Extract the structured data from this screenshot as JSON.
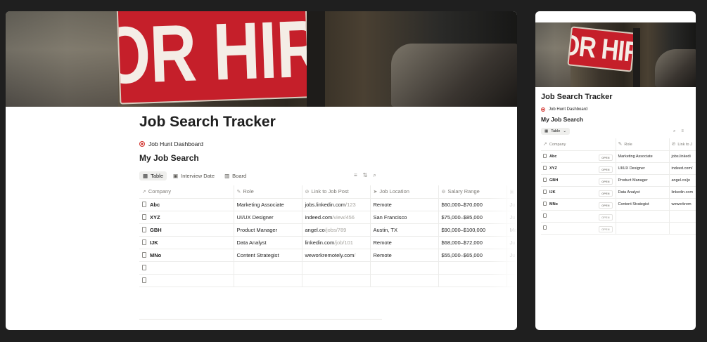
{
  "banner": {
    "sign_text": "FOR HIRE"
  },
  "page": {
    "title": "Job Search Tracker",
    "parent_link": "Job Hunt Dashboard",
    "database_title": "My Job Search"
  },
  "views": [
    {
      "label": "Table",
      "icon": "table-icon"
    },
    {
      "label": "Interview Date",
      "icon": "calendar-icon"
    },
    {
      "label": "Board",
      "icon": "board-icon"
    }
  ],
  "toolbar_icons": [
    "filter-icon",
    "sort-icon",
    "search-icon"
  ],
  "columns": [
    {
      "label": "Company",
      "icon": "cursor-icon"
    },
    {
      "label": "Role",
      "icon": "role-icon"
    },
    {
      "label": "Link to Job Post",
      "icon": "link-icon"
    },
    {
      "label": "Job Location",
      "icon": "location-icon"
    },
    {
      "label": "Salary Range",
      "icon": "money-icon"
    },
    {
      "label": "",
      "icon": "calendar-icon"
    }
  ],
  "rows": [
    {
      "company": "Abc",
      "role": "Marketing Associate",
      "link_main": "jobs.linkedin.com",
      "link_path": "/123",
      "location": "Remote",
      "salary": "$60,000–$70,000",
      "date": "Ju"
    },
    {
      "company": "XYZ",
      "role": "UI/UX Designer",
      "link_main": "indeed.com",
      "link_path": "/view/456",
      "location": "San Francisco",
      "salary": "$75,000–$85,000",
      "date": "Ju"
    },
    {
      "company": "GBH",
      "role": "Product Manager",
      "link_main": "angel.co",
      "link_path": "/jobs/789",
      "location": "Austin, TX",
      "salary": "$90,000–$100,000",
      "date": "Ma"
    },
    {
      "company": "IJK",
      "role": "Data Analyst",
      "link_main": "linkedin.com",
      "link_path": "/job/101",
      "location": "Remote",
      "salary": "$68,000–$72,000",
      "date": "Ju"
    },
    {
      "company": "MNo",
      "role": "Content Strategist",
      "link_main": "weworkremotely.com",
      "link_path": "/",
      "location": "Remote",
      "salary": "$55,000–$65,000",
      "date": "Ju"
    }
  ],
  "side_preview": {
    "title": "Job Search Tracker",
    "parent_link": "Job Hunt Dashboard",
    "database_title": "My Job Search",
    "view_label": "Table",
    "columns": [
      "Company",
      "Role",
      "Link to J"
    ],
    "open_label": "OPEN",
    "rows": [
      {
        "company": "Abc",
        "role": "Marketing Associate",
        "link": "jobs.linkedi"
      },
      {
        "company": "XYZ",
        "role": "UI/UX Designer",
        "link": "indeed.com/"
      },
      {
        "company": "GBH",
        "role": "Product Manager",
        "link": "angel.co/jo"
      },
      {
        "company": "IJK",
        "role": "Data Analyst",
        "link": "linkedin.com"
      },
      {
        "company": "MNo",
        "role": "Content Strategist",
        "link": "weworkrem"
      }
    ]
  }
}
